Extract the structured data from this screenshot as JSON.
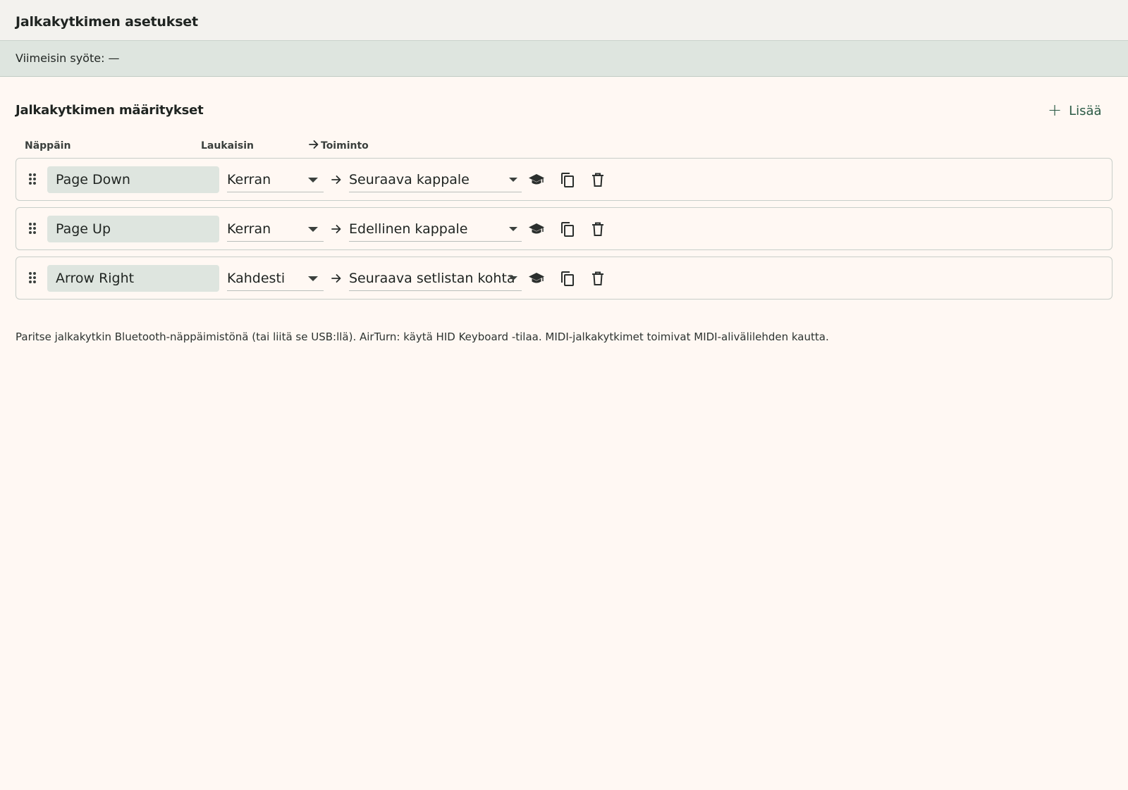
{
  "header": {
    "title": "Jalkakytkimen asetukset"
  },
  "status": {
    "last_input": "Viimeisin syöte: —"
  },
  "section": {
    "title": "Jalkakytkimen määritykset",
    "add_label": "Lisää"
  },
  "columns": {
    "key": "Näppäin",
    "trigger": "Laukaisin",
    "action": "Toiminto"
  },
  "rows": [
    {
      "key": "Page Down",
      "trigger": "Kerran",
      "action": "Seuraava kappale"
    },
    {
      "key": "Page Up",
      "trigger": "Kerran",
      "action": "Edellinen kappale"
    },
    {
      "key": "Arrow Right",
      "trigger": "Kahdesti",
      "action": "Seuraava setlistan kohta"
    }
  ],
  "hint": "Paritse jalkakytkin Bluetooth-näppäimistönä (tai liitä se USB:llä). AirTurn: käytä HID Keyboard -tilaa. MIDI-jalkakytkimet toimivat MIDI-alivälilehden kautta.",
  "icons": {
    "drag": "drag-handle-icon",
    "arrow": "arrow-right-icon",
    "learn": "graduation-cap-icon",
    "copy": "copy-icon",
    "delete": "trash-icon",
    "add": "plus-icon"
  },
  "colors": {
    "accent": "#2b5a45",
    "field_bg": "#dee5df",
    "page_bg": "#fff8f3"
  }
}
